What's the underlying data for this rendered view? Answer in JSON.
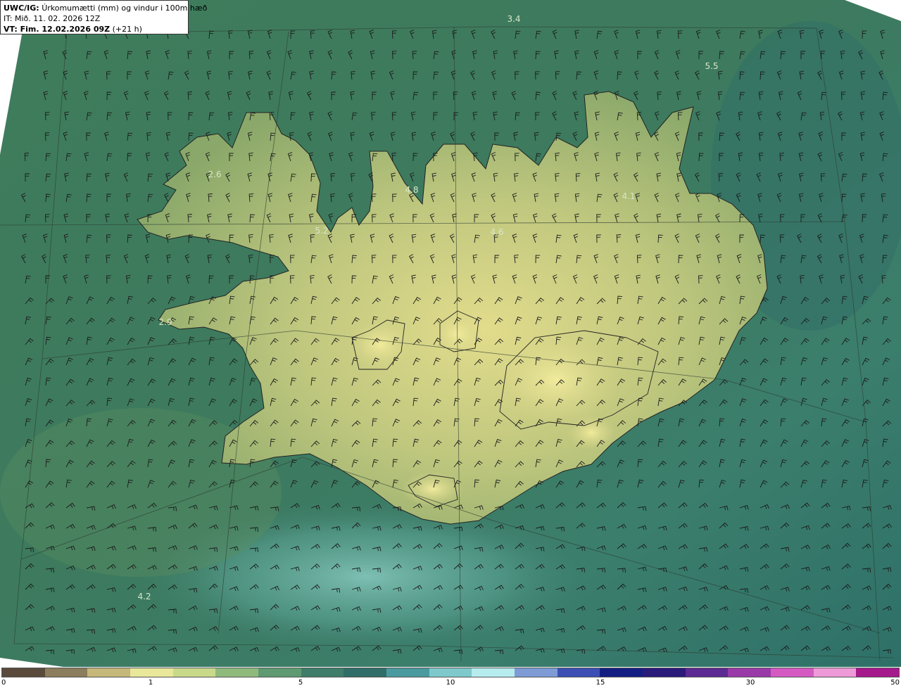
{
  "header": {
    "model": "UWC/IG:",
    "description": "Úrkomumætti (mm) og vindur i 100m hæð",
    "init_time": "IT: Mið. 11. 02. 2026 12Z",
    "valid_label": "VT: Fim. 12.02.2026 09Z",
    "lead_time": "(+21 h)"
  },
  "values": [
    {
      "label": "3.4"
    },
    {
      "label": "5.5"
    },
    {
      "label": "2.6"
    },
    {
      "label": "4.8"
    },
    {
      "label": "5.2"
    },
    {
      "label": "4.6"
    },
    {
      "label": "4.1"
    },
    {
      "label": "2.9"
    },
    {
      "label": "4.2"
    }
  ],
  "colorbar": {
    "ticks": [
      "0",
      "1",
      "5",
      "10",
      "15",
      "30",
      "50"
    ],
    "colors": [
      "#5a4a3c",
      "#8c7d5c",
      "#c6b77a",
      "#e8e79a",
      "#c8d98a",
      "#8fba7c",
      "#5f9a72",
      "#3f7d6a",
      "#2f6e68",
      "#4a9aa0",
      "#7fc9cc",
      "#b7ecee",
      "#7e9bd6",
      "#3d4fb4",
      "#141e82",
      "#2a1a7a",
      "#5c2a92",
      "#9a3aa8",
      "#d45ac2",
      "#ee9ad8",
      "#a6198c"
    ]
  }
}
